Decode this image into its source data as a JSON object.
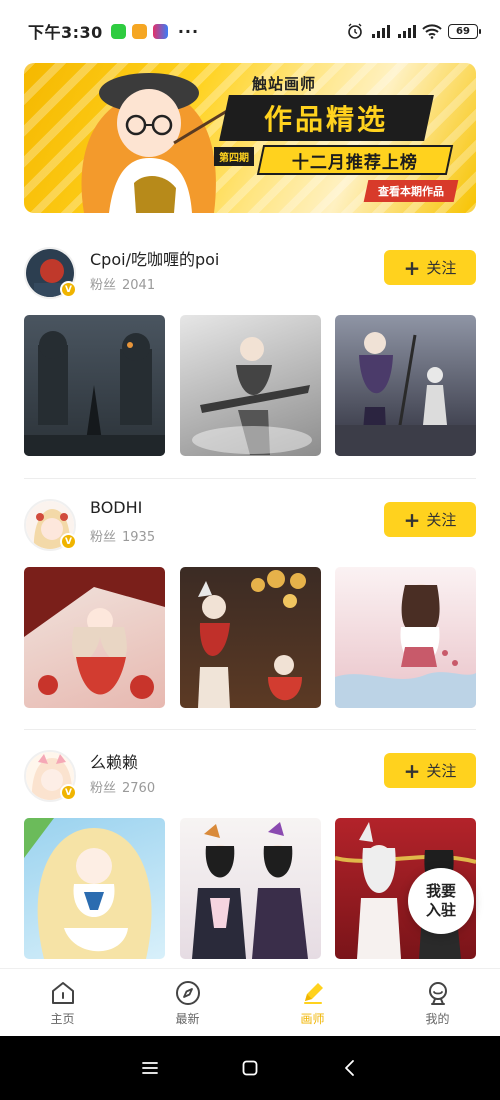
{
  "status_bar": {
    "time": "下午3:30",
    "battery": "69"
  },
  "banner": {
    "subtitle": "触站画师",
    "title": "作品精选",
    "issue": "第四期",
    "headline": "十二月推荐上榜",
    "cta": "查看本期作品"
  },
  "artists": [
    {
      "name": "Cpoi/吃咖喱的poi",
      "fans_label": "粉丝",
      "fans": "2041",
      "follow_label": "关注",
      "avatar_colors": [
        "#2c3e50",
        "#c0392b"
      ],
      "works": [
        {
          "colors": [
            "#4a5560",
            "#2b3238"
          ],
          "accent": "#1c2226"
        },
        {
          "colors": [
            "#d9d9d9",
            "#8d8d8d"
          ],
          "accent": "#3a3a3a"
        },
        {
          "colors": [
            "#6a6f80",
            "#2e2f3c"
          ],
          "accent": "#4b3b6a"
        }
      ]
    },
    {
      "name": "BODHI",
      "fans_label": "粉丝",
      "fans": "1935",
      "follow_label": "关注",
      "avatar_colors": [
        "#f6e2d6",
        "#d14b3c"
      ],
      "works": [
        {
          "colors": [
            "#f1e6e0",
            "#c8342b"
          ],
          "accent": "#d23c30"
        },
        {
          "colors": [
            "#3b2b24",
            "#c89a3e"
          ],
          "accent": "#e6b24a"
        },
        {
          "colors": [
            "#f6e8ea",
            "#d9a0a8"
          ],
          "accent": "#c85a6a"
        }
      ]
    },
    {
      "name": "么赖赖",
      "fans_label": "粉丝",
      "fans": "2760",
      "follow_label": "关注",
      "avatar_colors": [
        "#fbe3cf",
        "#f5a8b6"
      ],
      "works": [
        {
          "colors": [
            "#9ad2ef",
            "#f6e3a6"
          ],
          "accent": "#2b6cb0"
        },
        {
          "colors": [
            "#f2f0ef",
            "#c9b6c8"
          ],
          "accent": "#2a2a3a"
        },
        {
          "colors": [
            "#b3232a",
            "#e8e2e0"
          ],
          "accent": "#2a2a2a"
        }
      ]
    }
  ],
  "settle_button": {
    "line1": "我要",
    "line2": "入驻"
  },
  "tabs": [
    {
      "label": "主页",
      "icon": "home-icon"
    },
    {
      "label": "最新",
      "icon": "compass-icon"
    },
    {
      "label": "画师",
      "icon": "pen-icon",
      "active": true
    },
    {
      "label": "我的",
      "icon": "profile-icon"
    }
  ],
  "colors": {
    "accent": "#ffd21e",
    "active_tab": "#f0b400",
    "badge": "#f0b400"
  }
}
